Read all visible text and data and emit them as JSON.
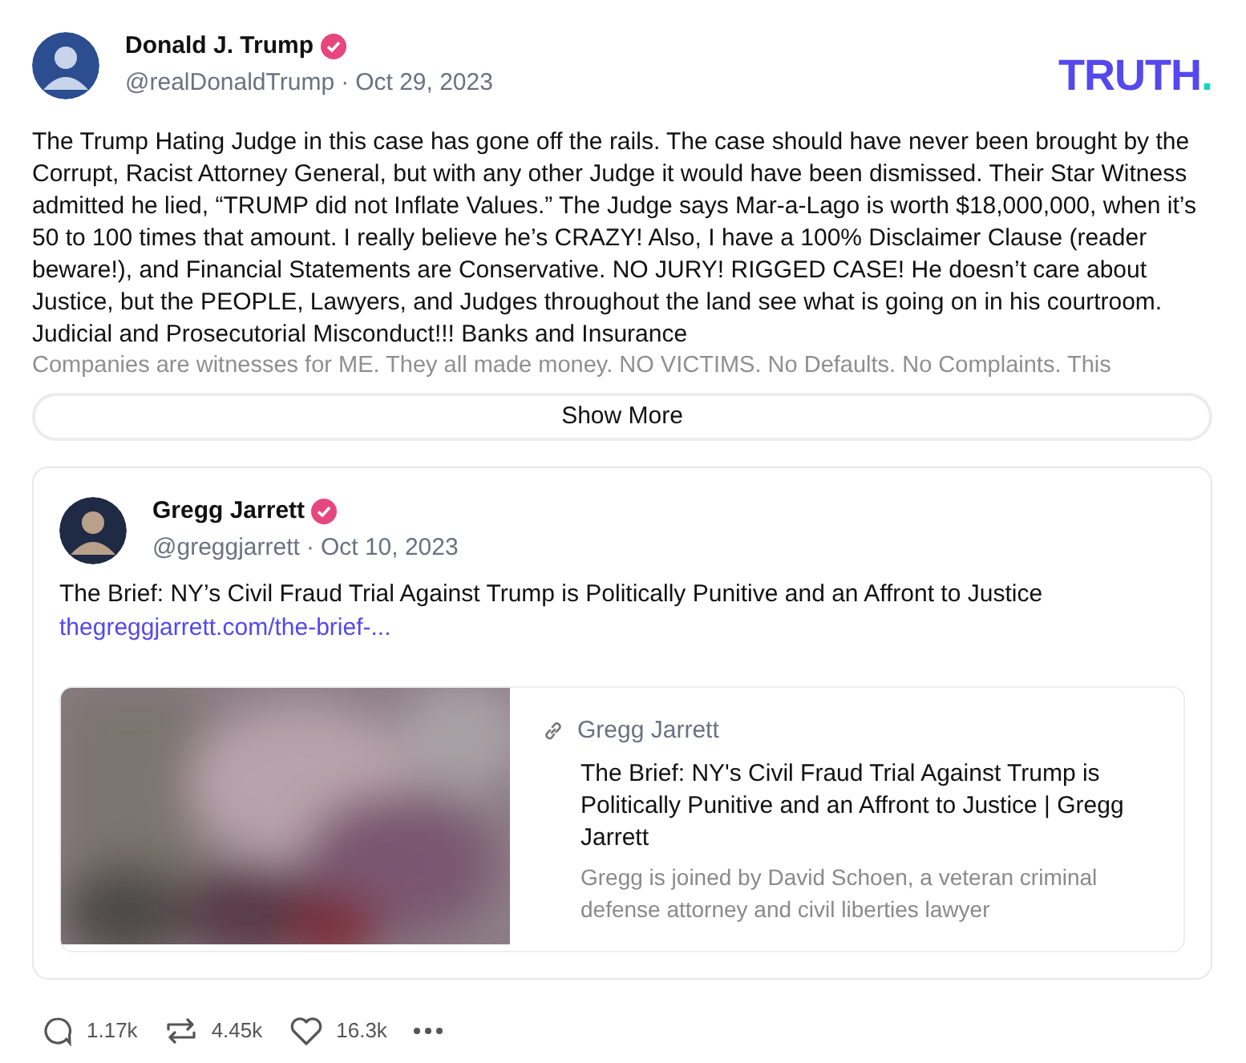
{
  "post": {
    "author": "Donald J. Trump",
    "verified": true,
    "handle": "@realDonaldTrump",
    "separator": "·",
    "date": "Oct 29, 2023",
    "logo": {
      "text": "TRUTH",
      "dot": "."
    },
    "body": "The Trump Hating Judge in this case has gone off the rails. The case should have never been brought by the Corrupt, Racist Attorney General, but with any other Judge it would have been dismissed. Their Star Witness admitted he lied, “TRUMP did not Inflate Values.” The Judge says Mar-a-Lago is worth $18,000,000, when it’s 50 to 100 times that amount. I really believe he’s CRAZY! Also, I have a 100% Disclaimer Clause (reader beware!), and Financial Statements are  Conservative. NO JURY! RIGGED CASE! He doesn’t care about Justice, but the PEOPLE, Lawyers, and Judges throughout the land see what is going on in his courtroom. Judicial and Prosecutorial Misconduct!!! Banks and Insurance",
    "body_faded": "Companies are witnesses for ME. They all made money. NO VICTIMS. No Defaults. No Complaints. This",
    "show_more": "Show More"
  },
  "quote": {
    "author": "Gregg Jarrett",
    "verified": true,
    "handle": "@greggjarrett",
    "separator": "·",
    "date": "Oct 10, 2023",
    "text": "The Brief: NY’s Civil Fraud Trial Against Trump is Politically Punitive and an Affront to Justice",
    "link": "thegreggjarrett.com/the-brief-...",
    "preview": {
      "site": "Gregg Jarrett",
      "title": "The Brief: NY's Civil Fraud Trial Against Trump is Politically Punitive and an Affront to Justice | Gregg Jarrett",
      "description": "Gregg is joined by David Schoen, a veteran criminal defense attorney and civil liberties lawyer"
    }
  },
  "actions": [
    {
      "kind": "reply",
      "count": "1.17k"
    },
    {
      "kind": "repost",
      "count": "4.45k"
    },
    {
      "kind": "like",
      "count": "16.3k"
    },
    {
      "kind": "more"
    }
  ]
}
